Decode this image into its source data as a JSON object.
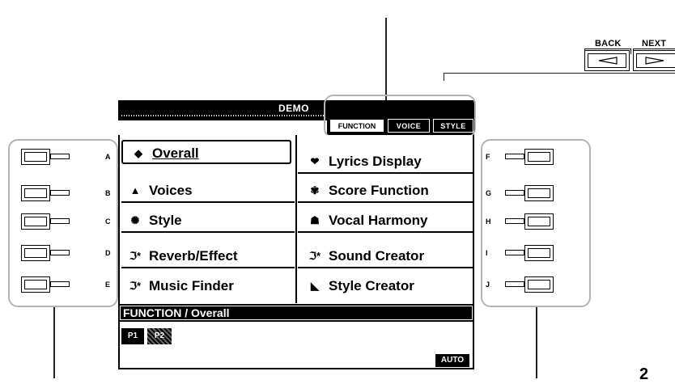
{
  "nav": {
    "back_label": "BACK",
    "next_label": "NEXT"
  },
  "screen": {
    "title": "DEMO",
    "tabs": [
      {
        "label": "FUNCTION",
        "active": true
      },
      {
        "label": "VOICE",
        "active": false
      },
      {
        "label": "STYLE",
        "active": false
      }
    ],
    "items_left": [
      {
        "letter": "A",
        "icon": "panel-icon",
        "glyph": "◆",
        "label": "Overall",
        "selected": true
      },
      {
        "letter": "B",
        "icon": "mountain-icon",
        "glyph": "▲",
        "label": "Voices"
      },
      {
        "letter": "C",
        "icon": "cat-icon",
        "glyph": "✺",
        "label": "Style"
      },
      {
        "letter": "D",
        "icon": "reverb-icon",
        "glyph": "ℑ*",
        "label": "Reverb/Effect"
      },
      {
        "letter": "E",
        "icon": "music-finder-icon",
        "glyph": "ℑ*",
        "label": "Music Finder"
      }
    ],
    "items_right": [
      {
        "letter": "F",
        "icon": "lyrics-icon",
        "glyph": "❤",
        "label": "Lyrics Display"
      },
      {
        "letter": "G",
        "icon": "score-icon",
        "glyph": "✾",
        "label": "Score Function"
      },
      {
        "letter": "H",
        "icon": "harmony-icon",
        "glyph": "☗",
        "label": "Vocal Harmony"
      },
      {
        "letter": "I",
        "icon": "sound-creator-icon",
        "glyph": "ℑ*",
        "label": "Sound Creator"
      },
      {
        "letter": "J",
        "icon": "style-creator-icon",
        "glyph": "◣",
        "label": "Style Creator"
      }
    ],
    "status": "FUNCTION / Overall",
    "pages": [
      "P1",
      "P2"
    ],
    "auto_label": "AUTO"
  },
  "page_number": "2"
}
